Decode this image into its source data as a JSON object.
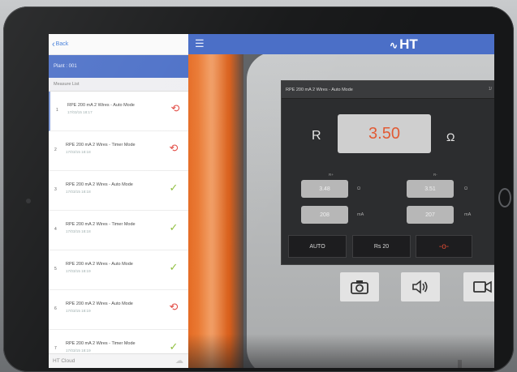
{
  "left": {
    "back_label": "Back",
    "plant_label": "Plant : 001",
    "list_header": "Measure List",
    "items": [
      {
        "num": "1",
        "title": "RPE 200 mA 2 Wires - Auto Mode",
        "date": "17/03/15 18:17",
        "status": "fail"
      },
      {
        "num": "2",
        "title": "RPE 200 mA 2 Wires - Timer Mode",
        "date": "17/03/15 18:18",
        "status": "fail"
      },
      {
        "num": "3",
        "title": "RPE 200 mA 2 Wires - Auto Mode",
        "date": "17/03/15 18:18",
        "status": "pass"
      },
      {
        "num": "4",
        "title": "RPE 200 mA 2 Wires - Timer Mode",
        "date": "17/03/15 18:18",
        "status": "pass"
      },
      {
        "num": "5",
        "title": "RPE 200 mA 2 Wires - Auto Mode",
        "date": "17/03/15 18:19",
        "status": "pass"
      },
      {
        "num": "6",
        "title": "RPE 200 mA 2 Wires - Auto Mode",
        "date": "17/03/15 18:19",
        "status": "fail"
      },
      {
        "num": "7",
        "title": "RPE 200 mA 2 Wires - Timer Mode",
        "date": "17/03/15 18:19",
        "status": "pass"
      }
    ],
    "footer_label": "HT Cloud"
  },
  "header": {
    "logo": "HT"
  },
  "meter": {
    "title": "RPE 200 mA 2 Wires - Auto Mode",
    "title_end": "1/",
    "r_symbol": "R",
    "main_value": "3.50",
    "main_unit": "Ω",
    "r_plus_label": "R+",
    "r_minus_label": "R-",
    "r_plus_value": "3.48",
    "r_minus_value": "3.51",
    "r_unit": "Ω",
    "i_plus_value": "208",
    "i_minus_value": "207",
    "i_unit": "mA",
    "btn_auto": "AUTO",
    "btn_rs": "Rs 20",
    "btn_wire": "-o-"
  },
  "colors": {
    "accent": "#4b6fc7",
    "fail": "#e24a43",
    "pass": "#8fbf3d",
    "main_value": "#e15b35"
  },
  "icons": [
    "camera-icon",
    "speaker-icon",
    "video-icon",
    "menu-icon",
    "back-chevron-icon",
    "cloud-icon"
  ]
}
